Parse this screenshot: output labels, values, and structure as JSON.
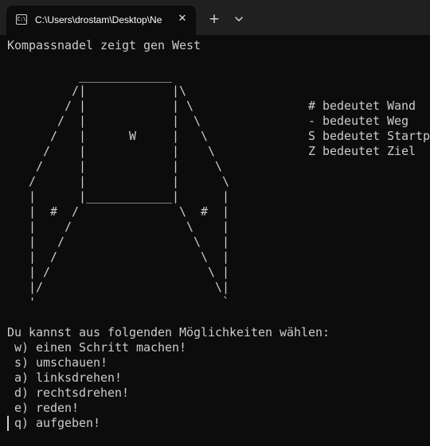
{
  "window": {
    "tab_title": "C:\\Users\\drostam\\Desktop\\Ne",
    "tab_icon_text": "C:\\",
    "close_symbol": "✕",
    "new_tab_symbol": "+",
    "dropdown_icon": "chevron-down-icon"
  },
  "terminal": {
    "lines": [
      "Kompassnadel zeigt gen West",
      "",
      "          _____________",
      "         /|            |\\",
      "        / |            | \\                # bedeutet Wand",
      "       /  |            |  \\               - bedeutet Weg",
      "      /   |      W     |   \\              S bedeutet Startpunkt",
      "     /    |            |    \\             Z bedeutet Ziel",
      "    /     |            |     \\",
      "   /      |            |      \\",
      "   |      |____________|      |",
      "   |  #  /              \\  #  |",
      "   |    /                \\    |",
      "   |   /                  \\   |",
      "   |  /                    \\  |",
      "   | /                      \\ |",
      "   |/                        \\|",
      "   '                          `",
      "",
      "Du kannst aus folgenden Möglichkeiten wählen:",
      " w) einen Schritt machen!",
      " s) umschauen!",
      " a) linksdrehen!",
      " d) rechtsdrehen!",
      " e) reden!",
      " q) aufgeben!"
    ]
  },
  "colors": {
    "terminal_background": "#0c0c0c",
    "terminal_foreground": "#cccccc",
    "titlebar_background": "#202020"
  }
}
